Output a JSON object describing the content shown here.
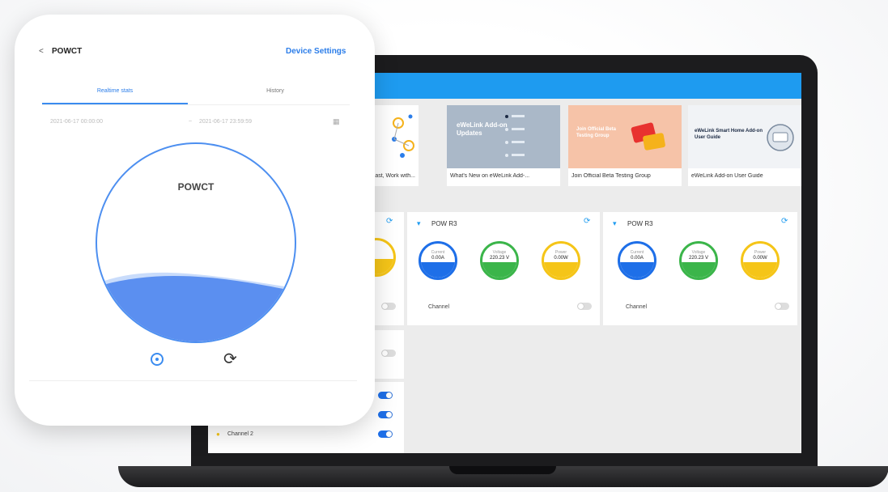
{
  "phone": {
    "back_glyph": "<",
    "title": "POWCT",
    "settings_label": "Device Settings",
    "tabs": [
      "Realtime stats",
      "History"
    ],
    "date_start": "2021-06-17 00:00:00",
    "date_end": "2021-06-17 23:59:59",
    "ring_title": "POWCT",
    "accent": "#3b8cf0",
    "wave_fill_level": 0.32
  },
  "laptop": {
    "banners": [
      {
        "caption": "...ast, Work with...",
        "text": ""
      },
      {
        "caption": "What's New on eWeLink Add-...",
        "text": "eWeLink Add-on Updates"
      },
      {
        "caption": "Join Official Beta Testing Group",
        "text": "Join Official Beta Testing Group"
      },
      {
        "caption": "eWeLink Add-on User Guide",
        "text": "eWeLink Smart Home Add-on User Guide"
      }
    ],
    "panels": [
      {
        "title": "POW R3",
        "channel": "Channel"
      },
      {
        "title": "POW R3",
        "channel": "Channel"
      }
    ],
    "gauges": [
      {
        "label": "Current",
        "value": "0.00A",
        "color": "#1e6fe8"
      },
      {
        "label": "Voltage",
        "value": "220.23 V",
        "color": "#3bb54a"
      },
      {
        "label": "Power",
        "value": "0.00W",
        "color": "#f5c518"
      }
    ],
    "left_channel": "Channel 2",
    "topbar_color": "#1e9bf0"
  }
}
